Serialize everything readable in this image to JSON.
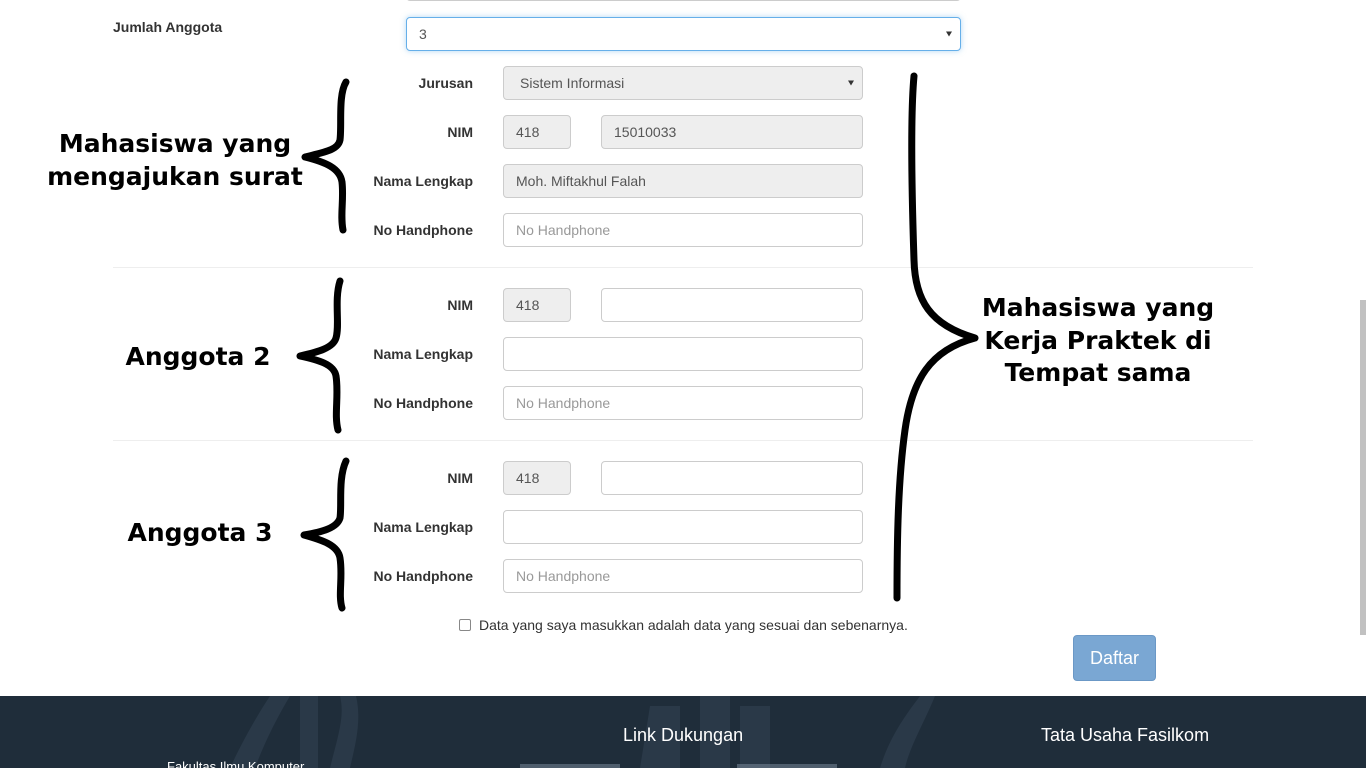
{
  "form": {
    "jumlah_anggota": {
      "label": "Jumlah Anggota",
      "value": "3"
    },
    "applicant": {
      "jurusan": {
        "label": "Jurusan",
        "value": "Sistem Informasi"
      },
      "nim": {
        "label": "NIM",
        "prefix": "418",
        "value": "15010033"
      },
      "nama": {
        "label": "Nama Lengkap",
        "value": "Moh. Miftakhul Falah"
      },
      "hp": {
        "label": "No Handphone",
        "placeholder": "No Handphone"
      }
    },
    "anggota2": {
      "nim": {
        "label": "NIM",
        "prefix": "418",
        "value": ""
      },
      "nama": {
        "label": "Nama Lengkap",
        "value": ""
      },
      "hp": {
        "label": "No Handphone",
        "placeholder": "No Handphone"
      }
    },
    "anggota3": {
      "nim": {
        "label": "NIM",
        "prefix": "418",
        "value": ""
      },
      "nama": {
        "label": "Nama Lengkap",
        "value": ""
      },
      "hp": {
        "label": "No Handphone",
        "placeholder": "No Handphone"
      }
    },
    "agreement": "Data yang saya masukkan adalah data yang sesuai dan sebenarnya.",
    "submit_label": "Daftar"
  },
  "annotations": {
    "applicant_line1": "Mahasiswa yang",
    "applicant_line2": "mengajukan surat",
    "anggota2": "Anggota 2",
    "anggota3": "Anggota 3",
    "right_line1": "Mahasiswa yang",
    "right_line2": "Kerja Praktek di",
    "right_line3": "Tempat sama"
  },
  "footer": {
    "col1_text": "Fakultas Ilmu Komputer",
    "col2_title": "Link Dukungan",
    "col3_title": "Tata Usaha Fasilkom"
  },
  "colors": {
    "footer_bg": "#1f2d3a",
    "button_bg": "#7aa7d3",
    "readonly_bg": "#eeeeee",
    "focus_border": "#66afe9"
  }
}
